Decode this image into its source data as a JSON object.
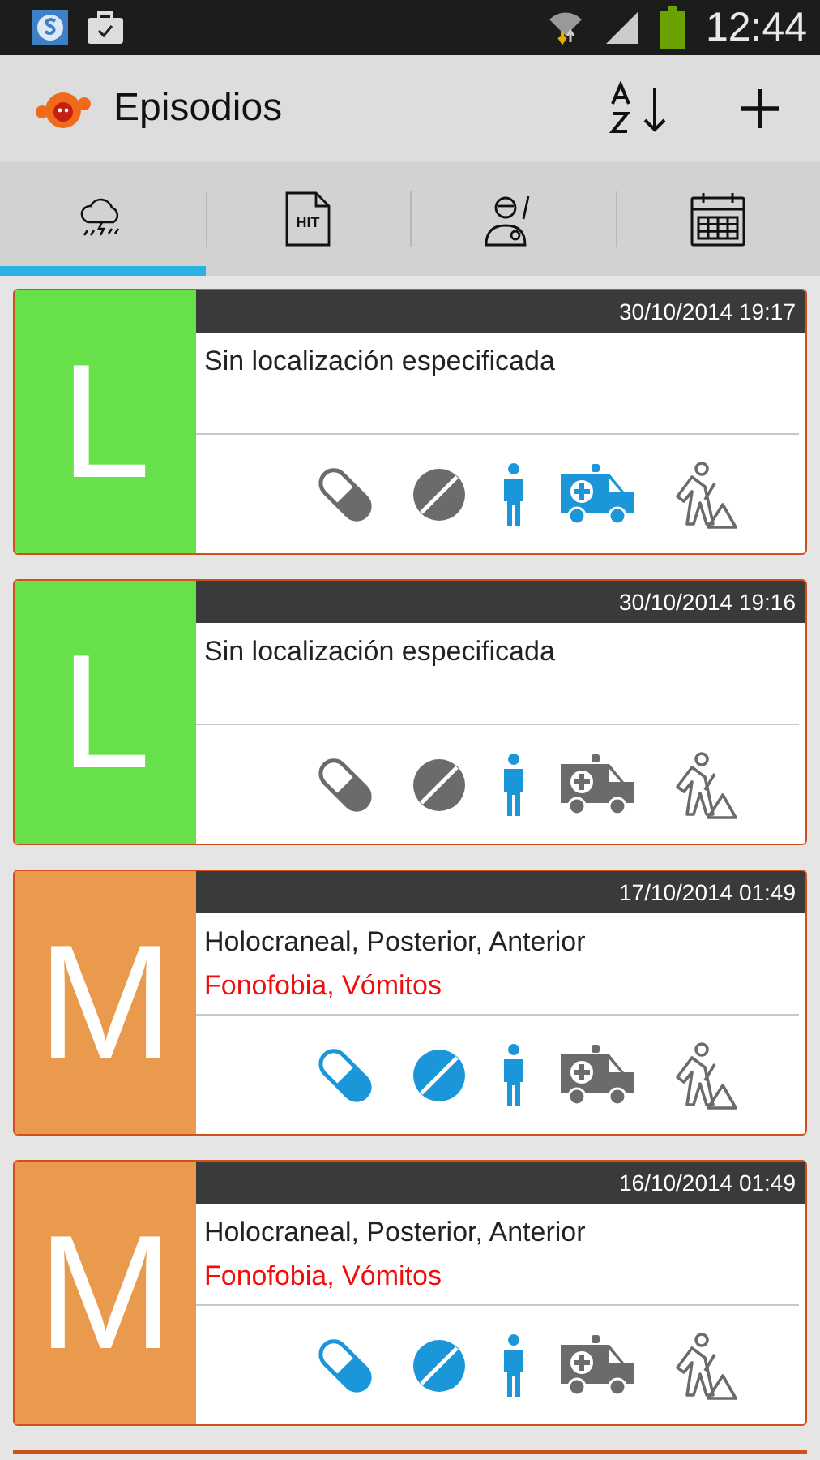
{
  "status_bar": {
    "time": "12:44"
  },
  "app_bar": {
    "title": "Episodios"
  },
  "tabs": [
    {
      "kind": "storm",
      "selected": true
    },
    {
      "kind": "document",
      "label": "HIT",
      "selected": false
    },
    {
      "kind": "doctor",
      "selected": false
    },
    {
      "kind": "calendar",
      "selected": false
    }
  ],
  "episodes": [
    {
      "letter": "L",
      "color": "#66e14a",
      "datetime": "30/10/2014 19:17",
      "location": "Sin localización especificada",
      "capsule": false,
      "tablet": false,
      "person": true,
      "ambulance": true,
      "work": false
    },
    {
      "letter": "L",
      "color": "#66e14a",
      "datetime": "30/10/2014 19:16",
      "location": "Sin localización especificada",
      "capsule": false,
      "tablet": false,
      "person": true,
      "ambulance": false,
      "work": false
    },
    {
      "letter": "M",
      "color": "#e99a4c",
      "datetime": "17/10/2014 01:49",
      "location": "Holocraneal, Posterior, Anterior",
      "symptoms": "Fonofobia, Vómitos",
      "capsule": true,
      "tablet": true,
      "person": true,
      "ambulance": false,
      "work": false
    },
    {
      "letter": "M",
      "color": "#e99a4c",
      "datetime": "16/10/2014 01:49",
      "location": "Holocraneal, Posterior, Anterior",
      "symptoms": "Fonofobia, Vómitos",
      "capsule": true,
      "tablet": true,
      "person": true,
      "ambulance": false,
      "work": false
    }
  ]
}
